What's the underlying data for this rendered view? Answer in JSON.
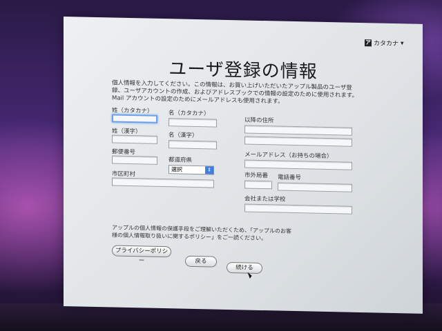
{
  "keyboard_menu": {
    "icon": "keyboard-icon",
    "label": "カタカナ",
    "arrow": "▾",
    "kb_glyph": "ア"
  },
  "title": "ユーザ登録の情報",
  "intro": "個人情報を入力してください。この情報は、お買い上げいただいたアップル製品のユーザ登録、ユーザアカウントの作成、およびアドレスブックでの情報の設定のために使用されます。Mail アカウントの設定のためにメールアドレスも使用されます。",
  "form": {
    "last_name_kana": "姓（カタカナ）",
    "first_name_kana": "名（カタカナ）",
    "last_name_kanji": "姓（漢字）",
    "first_name_kanji": "名（漢字）",
    "postal_code": "郵便番号",
    "prefecture": "都道府県",
    "prefecture_value": "選択",
    "city": "市区町村",
    "address_after": "以降の住所",
    "email": "メールアドレス（お持ちの場合）",
    "area_code": "市外局番",
    "phone": "電話番号",
    "company": "会社または学校"
  },
  "privacy_note": "アップルの個人情報の保護手段をご理解いただくため、「アップルのお客様の個人情報取り扱いに関するポリシー」をご一読ください。",
  "buttons": {
    "privacy": "プライバシーポリシー",
    "back": "戻る",
    "continue": "続ける"
  }
}
